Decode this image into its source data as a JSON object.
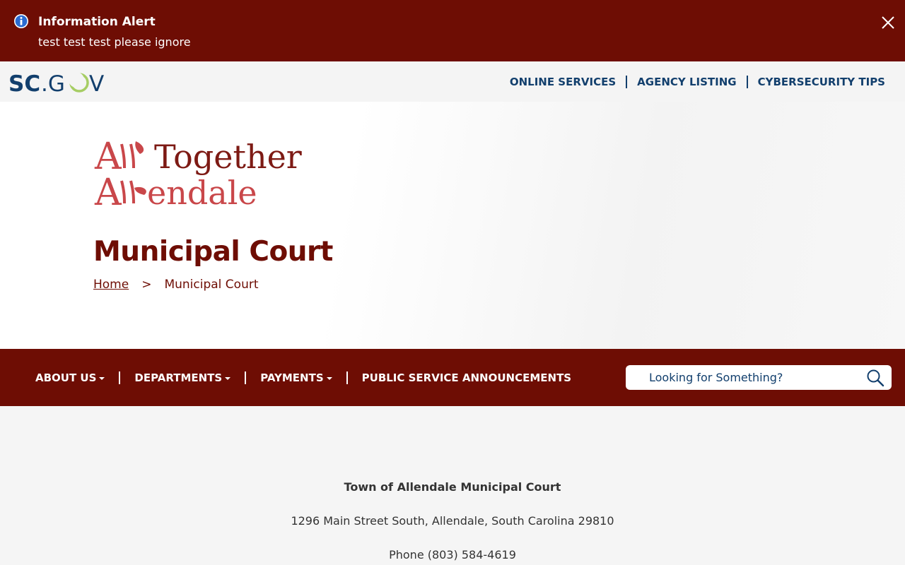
{
  "alert": {
    "title": "Information Alert",
    "message": "test test test please ignore",
    "info_icon": "info-icon",
    "close_icon": "close-icon",
    "background": "#6e0d04"
  },
  "top_bar": {
    "logo_text": "SC.GOV",
    "links": [
      "ONLINE SERVICES",
      "AGENCY LISTING",
      "CYBERSECURITY TIPS"
    ],
    "link_color": "#123f6d"
  },
  "hero": {
    "logo_text": "All Together Allendale",
    "title": "Municipal Court",
    "breadcrumb": {
      "home": "Home",
      "separator": ">",
      "current": "Municipal Court"
    },
    "title_color": "#6e0d04"
  },
  "main_nav": {
    "items": [
      {
        "label": "ABOUT US",
        "dropdown": true
      },
      {
        "label": "DEPARTMENTS",
        "dropdown": true
      },
      {
        "label": "PAYMENTS",
        "dropdown": true
      },
      {
        "label": "PUBLIC SERVICE ANNOUNCEMENTS",
        "dropdown": false
      }
    ],
    "search_placeholder": "Looking for Something?",
    "search_icon": "search-icon"
  },
  "content": {
    "court_name": "Town of Allendale Municipal Court",
    "address": "1296 Main Street South, Allendale, South Carolina 29810",
    "phone": "Phone (803) 584-4619"
  }
}
